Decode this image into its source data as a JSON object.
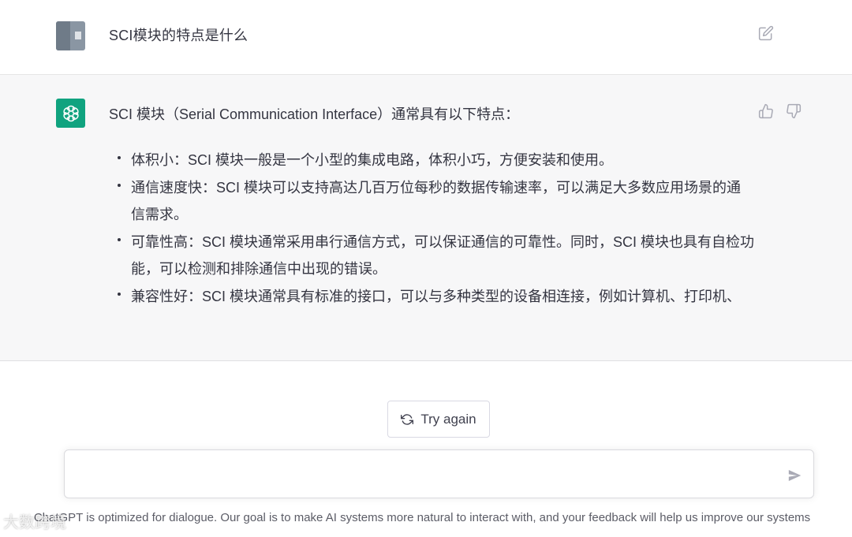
{
  "user_message": {
    "text": "SCI模块的特点是什么"
  },
  "assistant_message": {
    "intro": "SCI 模块（Serial Communication Interface）通常具有以下特点：",
    "bullets": [
      "体积小：SCI 模块一般是一个小型的集成电路，体积小巧，方便安装和使用。",
      "通信速度快：SCI 模块可以支持高达几百万位每秒的数据传输速率，可以满足大多数应用场景的通信需求。",
      "可靠性高：SCI 模块通常采用串行通信方式，可以保证通信的可靠性。同时，SCI 模块也具有自检功能，可以检测和排除通信中出现的错误。",
      "兼容性好：SCI 模块通常具有标准的接口，可以与多种类型的设备相连接，例如计算机、打印机、"
    ]
  },
  "actions": {
    "try_again_label": "Try again"
  },
  "composer": {
    "value": "",
    "placeholder": ""
  },
  "footer": {
    "text": "ChatGPT is optimized for dialogue. Our goal is to make AI systems more natural to interact with, and your feedback will help us improve our systems"
  },
  "watermark": {
    "text": "大数跨境"
  },
  "icons": {
    "edit": "edit-icon",
    "thumbs_up": "thumbs-up-icon",
    "thumbs_down": "thumbs-down-icon",
    "refresh": "refresh-icon",
    "send": "send-icon",
    "openai_logo": "openai-logo-icon"
  },
  "colors": {
    "accent": "#10a37f",
    "assistant_bg": "#f7f7f8",
    "text": "#343541"
  }
}
